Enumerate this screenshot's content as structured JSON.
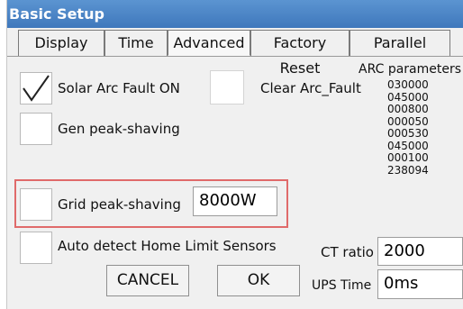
{
  "window": {
    "title": "Basic Setup"
  },
  "tabs": [
    {
      "label": "Display"
    },
    {
      "label": "Time"
    },
    {
      "label": "Advanced"
    },
    {
      "label": "Factory Reset"
    },
    {
      "label": "Parallel"
    }
  ],
  "active_tab": "Advanced",
  "options": {
    "solar_arc_fault": {
      "label": "Solar Arc Fault ON",
      "checked": true
    },
    "clear_arc_fault": {
      "label": "Clear Arc_Fault"
    },
    "gen_peak_shaving": {
      "label": "Gen peak-shaving",
      "checked": false
    },
    "grid_peak_shaving": {
      "label": "Grid peak-shaving",
      "checked": false,
      "value": "8000W"
    },
    "auto_detect": {
      "label": "Auto detect Home Limit Sensors",
      "checked": false
    }
  },
  "arc_parameters": {
    "title": "ARC parameters",
    "values": [
      "030000",
      "045000",
      "000800",
      "000050",
      "000530",
      "045000",
      "000100",
      "238094"
    ]
  },
  "ct_ratio": {
    "label": "CT ratio",
    "value": "2000"
  },
  "ups_time": {
    "label": "UPS Time",
    "value": "0ms"
  },
  "buttons": {
    "cancel": "CANCEL",
    "ok": "OK"
  },
  "colors": {
    "titlebar": "#4a86c8",
    "highlight": "#e06a6a"
  }
}
